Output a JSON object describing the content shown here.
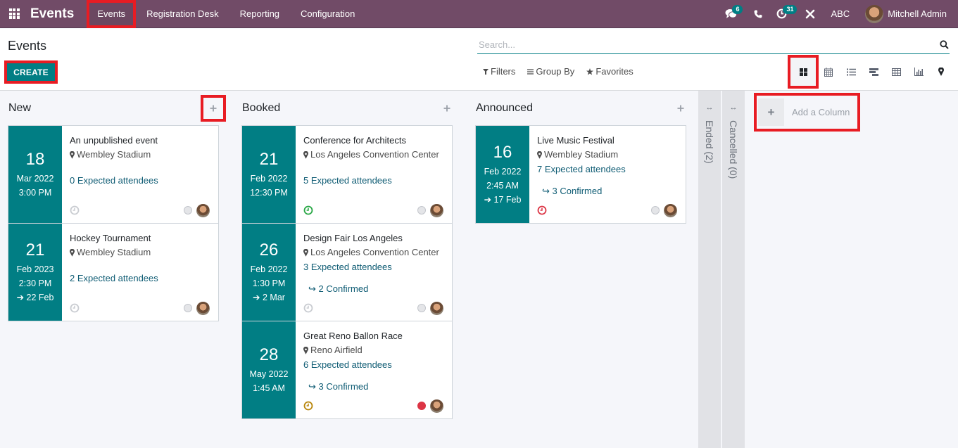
{
  "navbar": {
    "app_name": "Events",
    "menu": [
      {
        "label": "Events",
        "active": true
      },
      {
        "label": "Registration Desk",
        "active": false
      },
      {
        "label": "Reporting",
        "active": false
      },
      {
        "label": "Configuration",
        "active": false
      }
    ],
    "messages_badge": "6",
    "activities_badge": "31",
    "company": "ABC",
    "user_name": "Mitchell Admin"
  },
  "control_panel": {
    "breadcrumb": "Events",
    "create_label": "CREATE",
    "search_placeholder": "Search...",
    "search_value": "",
    "filters_label": "Filters",
    "group_by_label": "Group By",
    "favorites_label": "Favorites",
    "views": [
      "kanban",
      "calendar",
      "list",
      "gantt",
      "pivot",
      "graph",
      "map"
    ],
    "active_view": "kanban"
  },
  "colors": {
    "brand": "#714b67",
    "primary": "#017e84",
    "link": "#0f5c74",
    "annotation": "#e81c23"
  },
  "kanban": {
    "columns": [
      {
        "title": "New",
        "cards": [
          {
            "day": "18",
            "month_year": "Mar 2022",
            "time": "3:00 PM",
            "end": "",
            "title": "An unpublished event",
            "location": "Wembley Stadium",
            "attendees": "0 Expected attendees",
            "confirmed": "",
            "activity": "none",
            "state": "normal"
          },
          {
            "day": "21",
            "month_year": "Feb 2023",
            "time": "2:30 PM",
            "end": "22 Feb",
            "title": "Hockey Tournament",
            "location": "Wembley Stadium",
            "attendees": "2 Expected attendees",
            "confirmed": "",
            "activity": "none",
            "state": "normal"
          }
        ]
      },
      {
        "title": "Booked",
        "cards": [
          {
            "day": "21",
            "month_year": "Feb 2022",
            "time": "12:30 PM",
            "end": "",
            "title": "Conference for Architects",
            "location": "Los Angeles Convention Center",
            "attendees": "5 Expected attendees",
            "confirmed": "",
            "activity": "planned",
            "state": "normal"
          },
          {
            "day": "26",
            "month_year": "Feb 2022",
            "time": "1:30 PM",
            "end": "2 Mar",
            "title": "Design Fair Los Angeles",
            "location": "Los Angeles Convention Center",
            "attendees": "3 Expected attendees",
            "confirmed": "2 Confirmed",
            "activity": "none",
            "state": "normal"
          },
          {
            "day": "28",
            "month_year": "May 2022",
            "time": "1:45 AM",
            "end": "",
            "title": "Great Reno Ballon Race",
            "location": "Reno Airfield",
            "attendees": "6 Expected attendees",
            "confirmed": "3 Confirmed",
            "activity": "today",
            "state": "blocked"
          }
        ]
      },
      {
        "title": "Announced",
        "cards": [
          {
            "day": "16",
            "month_year": "Feb 2022",
            "time": "2:45 AM",
            "end": "17 Feb",
            "title": "Live Music Festival",
            "location": "Wembley Stadium",
            "attendees": "7 Expected attendees",
            "confirmed": "3 Confirmed",
            "activity": "overdue",
            "state": "normal"
          }
        ]
      }
    ],
    "folded_columns": [
      {
        "label": "Ended (2)"
      },
      {
        "label": "Cancelled (0)"
      }
    ],
    "add_column_label": "Add a Column"
  }
}
